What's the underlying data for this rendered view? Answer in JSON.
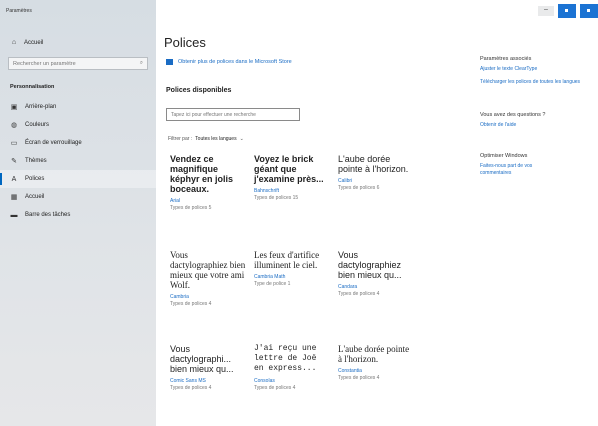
{
  "sidebar": {
    "title": "Paramètres",
    "home_label": "Accueil",
    "search_placeholder": "Rechercher un paramètre",
    "section_label": "Personnalisation",
    "items": [
      {
        "label": "Arrière-plan",
        "icon": "image-icon"
      },
      {
        "label": "Couleurs",
        "icon": "palette-icon"
      },
      {
        "label": "Écran de verrouillage",
        "icon": "lock-screen-icon"
      },
      {
        "label": "Thèmes",
        "icon": "brush-icon"
      },
      {
        "label": "Polices",
        "icon": "font-icon"
      },
      {
        "label": "Accueil",
        "icon": "start-icon"
      },
      {
        "label": "Barre des tâches",
        "icon": "taskbar-icon"
      }
    ],
    "active_index": 4
  },
  "window": {
    "min_label": "–"
  },
  "main": {
    "title": "Polices",
    "store_link": "Obtenir plus de polices dans le Microsoft Store",
    "available_heading": "Polices disponibles",
    "search_placeholder": "Tapez ici pour effectuer une recherche",
    "filter_label": "Filtrer par :",
    "filter_value": "Toutes les langues",
    "fonts": [
      {
        "sample": "Vendez ce magnifique képhyr en jolis boceaux.",
        "name": "Arial",
        "count": "Types de polices 5"
      },
      {
        "sample": "Voyez le brick géant que j'examine près...",
        "name": "Bahnschrift",
        "count": "Types de polices 15"
      },
      {
        "sample": "L'aube dorée pointe à l'horizon.",
        "name": "Calibri",
        "count": "Types de polices 6"
      },
      {
        "sample": "Vous dactylographiez bien mieux que votre ami Wolf.",
        "name": "Cambria",
        "count": "Types de polices 4"
      },
      {
        "sample": "Les feux d'artifice illuminent le ciel.",
        "name": "Cambria Math",
        "count": "Type de police 1"
      },
      {
        "sample": "Vous dactylographiez bien mieux qu...",
        "name": "Candara",
        "count": "Types de polices 4"
      },
      {
        "sample": "Vous dactylographi... bien mieux qu...",
        "name": "Comic Sans MS",
        "count": "Types de polices 4"
      },
      {
        "sample": "J'ai reçu une lettre de Joë en express...",
        "name": "Consolas",
        "count": "Types de polices 4"
      },
      {
        "sample": "L'aube dorée pointe à l'horizon.",
        "name": "Constantia",
        "count": "Types de polices 4"
      }
    ]
  },
  "right": {
    "related_heading": "Paramètres associés",
    "related_links": [
      "Ajuster le texte ClearType",
      "Télécharger les polices de toutes les langues"
    ],
    "question_heading": "Vous avez des questions ?",
    "help_link": "Obtenir de l'aide",
    "improve_heading": "Optimiser Windows",
    "feedback_link": "Faites-nous part de vos commentaires"
  }
}
